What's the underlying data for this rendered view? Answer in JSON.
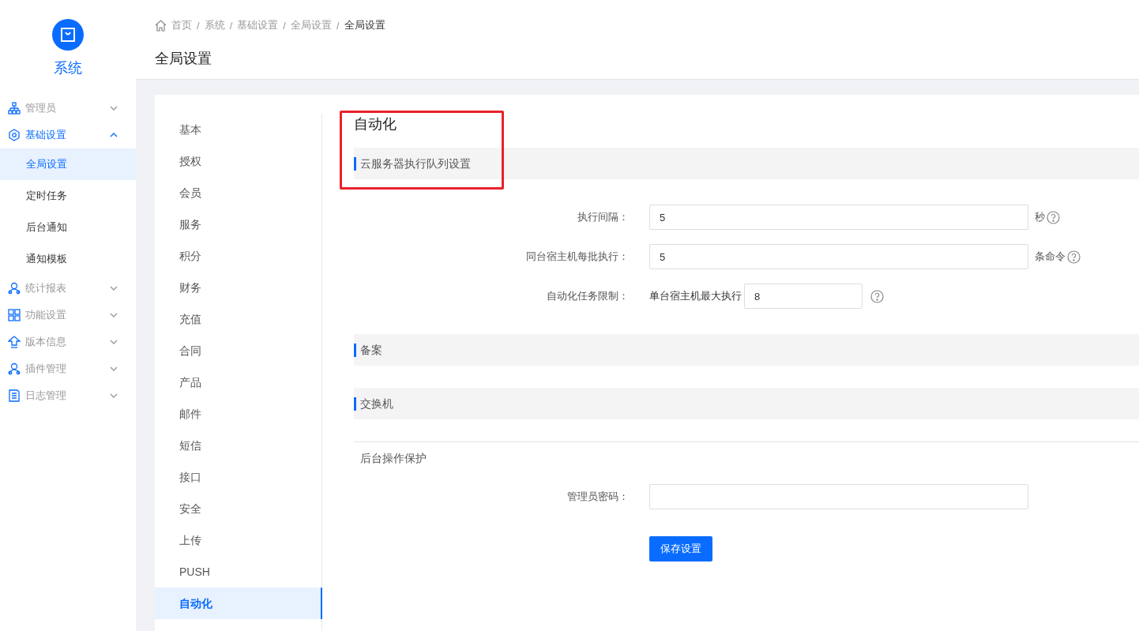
{
  "sidebar": {
    "title": "系统",
    "items": [
      {
        "label": "管理员",
        "kind": "org",
        "expanded": false
      },
      {
        "label": "基础设置",
        "kind": "hexagon",
        "expanded": true,
        "children": [
          {
            "label": "全局设置",
            "selected": true
          },
          {
            "label": "定时任务",
            "selected": false
          },
          {
            "label": "后台通知",
            "selected": false
          },
          {
            "label": "通知模板",
            "selected": false
          }
        ]
      },
      {
        "label": "统计报表",
        "kind": "user",
        "expanded": false
      },
      {
        "label": "功能设置",
        "kind": "grid",
        "expanded": false
      },
      {
        "label": "版本信息",
        "kind": "upload",
        "expanded": false
      },
      {
        "label": "插件管理",
        "kind": "user",
        "expanded": false
      },
      {
        "label": "日志管理",
        "kind": "doc",
        "expanded": false
      }
    ]
  },
  "breadcrumb": [
    {
      "kind": "link",
      "text": "首页",
      "current": false
    },
    {
      "kind": "separator",
      "text": "/"
    },
    {
      "kind": "link",
      "text": "系统",
      "current": false
    },
    {
      "kind": "separator",
      "text": "/"
    },
    {
      "kind": "link",
      "text": "基础设置",
      "current": false
    },
    {
      "kind": "separator",
      "text": "/"
    },
    {
      "kind": "link",
      "text": "全局设置",
      "current": false
    },
    {
      "kind": "separator",
      "text": "/"
    },
    {
      "kind": "link",
      "text": "全局设置",
      "current": true
    }
  ],
  "page_title": "全局设置",
  "settings_tabs": [
    {
      "label": "基本",
      "selected": false
    },
    {
      "label": "授权",
      "selected": false
    },
    {
      "label": "会员",
      "selected": false
    },
    {
      "label": "服务",
      "selected": false
    },
    {
      "label": "积分",
      "selected": false
    },
    {
      "label": "财务",
      "selected": false
    },
    {
      "label": "充值",
      "selected": false
    },
    {
      "label": "合同",
      "selected": false
    },
    {
      "label": "产品",
      "selected": false
    },
    {
      "label": "邮件",
      "selected": false
    },
    {
      "label": "短信",
      "selected": false
    },
    {
      "label": "接口",
      "selected": false
    },
    {
      "label": "安全",
      "selected": false
    },
    {
      "label": "上传",
      "selected": false
    },
    {
      "label": "PUSH",
      "selected": false
    },
    {
      "label": "自动化",
      "selected": true
    }
  ],
  "panel": {
    "title": "自动化",
    "sections": [
      {
        "title": "云服务器执行队列设置",
        "fields": [
          {
            "label": "执行间隔：",
            "value": "5",
            "unit": "秒",
            "help": true
          },
          {
            "label": "同台宿主机每批执行：",
            "value": "5",
            "unit": "条命令",
            "help": true
          },
          {
            "label": "自动化任务限制：",
            "prefix": "单台宿主机最大执行",
            "value": "8",
            "help": true
          }
        ]
      },
      {
        "title": "备案"
      },
      {
        "title": "交换机"
      }
    ],
    "protection": {
      "title": "后台操作保护",
      "fields": [
        {
          "label": "管理员密码："
        }
      ]
    },
    "save_button": "保存设置"
  }
}
